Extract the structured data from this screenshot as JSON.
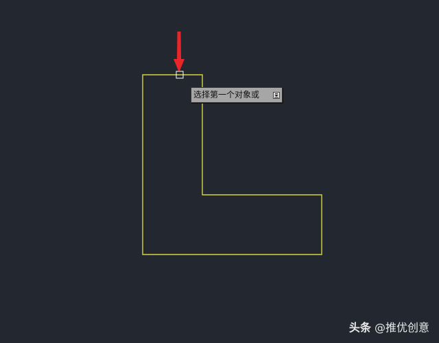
{
  "colors": {
    "background": "#232830",
    "shape_stroke": "#d8d640",
    "pickbox_stroke": "#ffffff",
    "arrow": "#e8262a",
    "tooltip_bg": "#a6a6a6"
  },
  "tooltip": {
    "prompt": "选择第一个对象或",
    "dropdown_icon": "arrow-down-icon"
  },
  "watermark": {
    "brand": "头条",
    "handle": "@推优创意"
  }
}
